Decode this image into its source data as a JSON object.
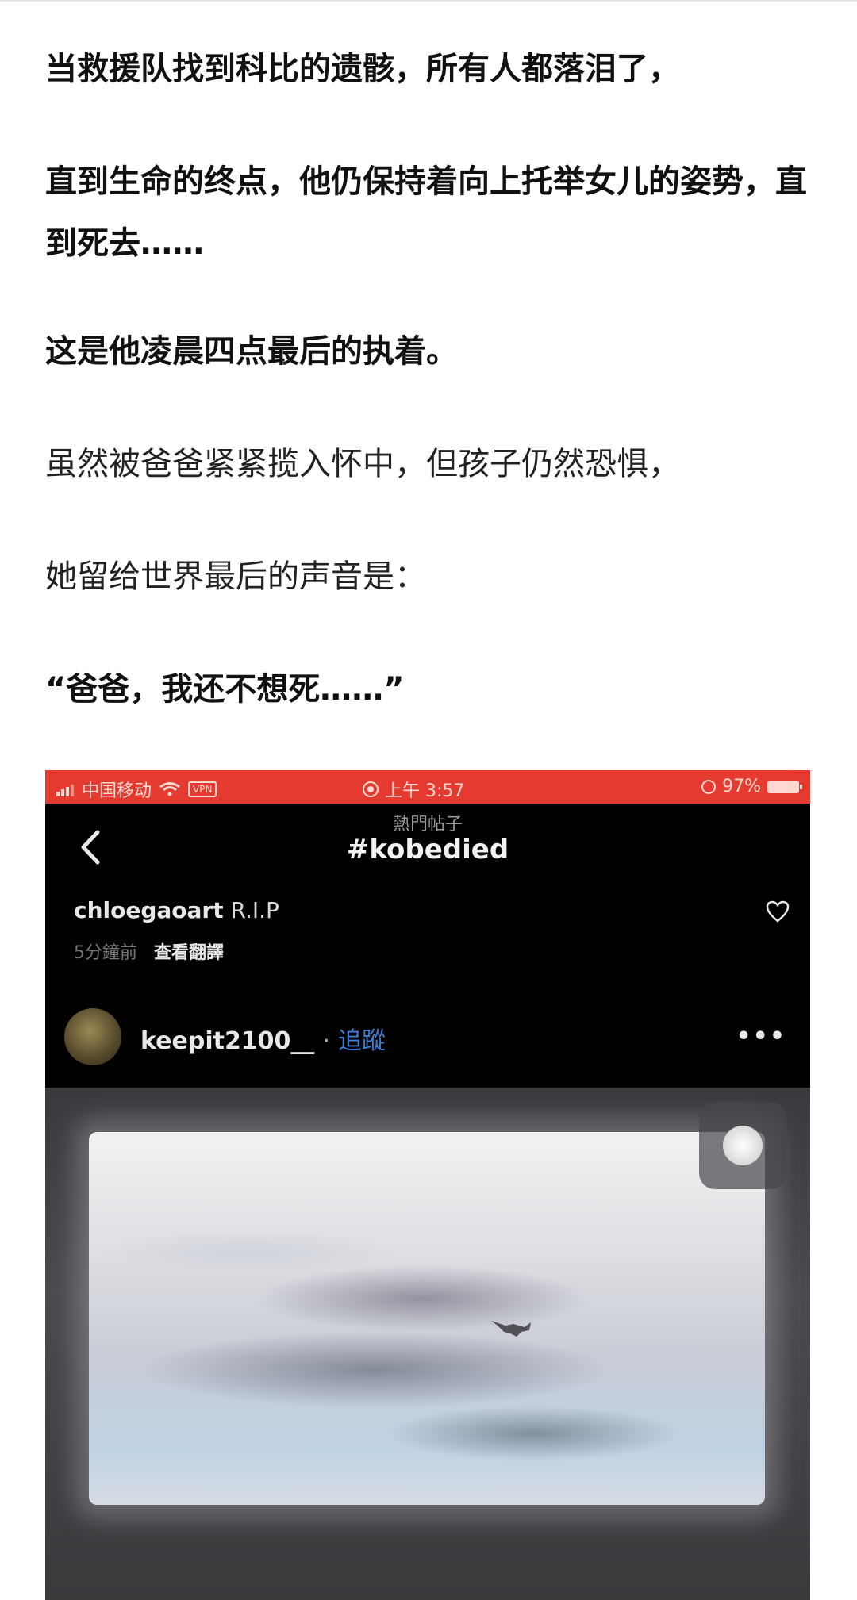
{
  "article": {
    "p1": "当救援队找到科比的遗骸，所有人都落泪了，",
    "p2": "直到生命的终点，他仍保持着向上托举女儿的姿势，直到死去……",
    "p3": "这是他凌晨四点最后的执着。",
    "p4": "虽然被爸爸紧紧揽入怀中，但孩子仍然恐惧，",
    "p5": "她留给世界最后的声音是：",
    "p6": "“爸爸，我还不想死……”"
  },
  "embedded": {
    "status": {
      "carrier": "中国移动",
      "vpn": "VPN",
      "time": "上午 3:57",
      "battery": "97%"
    },
    "nav": {
      "subtitle": "熱門帖子",
      "title": "#kobedied"
    },
    "caption": {
      "username": "chloegaoart",
      "text": "R.I.P",
      "time_ago": "5分鐘前",
      "translate": "查看翻譯"
    },
    "post": {
      "username": "keepit2100__",
      "follow": "追蹤",
      "more": "•••"
    },
    "colors": {
      "status_bar": "#e53a2f",
      "follow_link": "#3d7fd4"
    },
    "icons": [
      "back-icon",
      "heart-icon",
      "more-icon",
      "signal-icon",
      "wifi-icon",
      "battery-icon"
    ]
  }
}
